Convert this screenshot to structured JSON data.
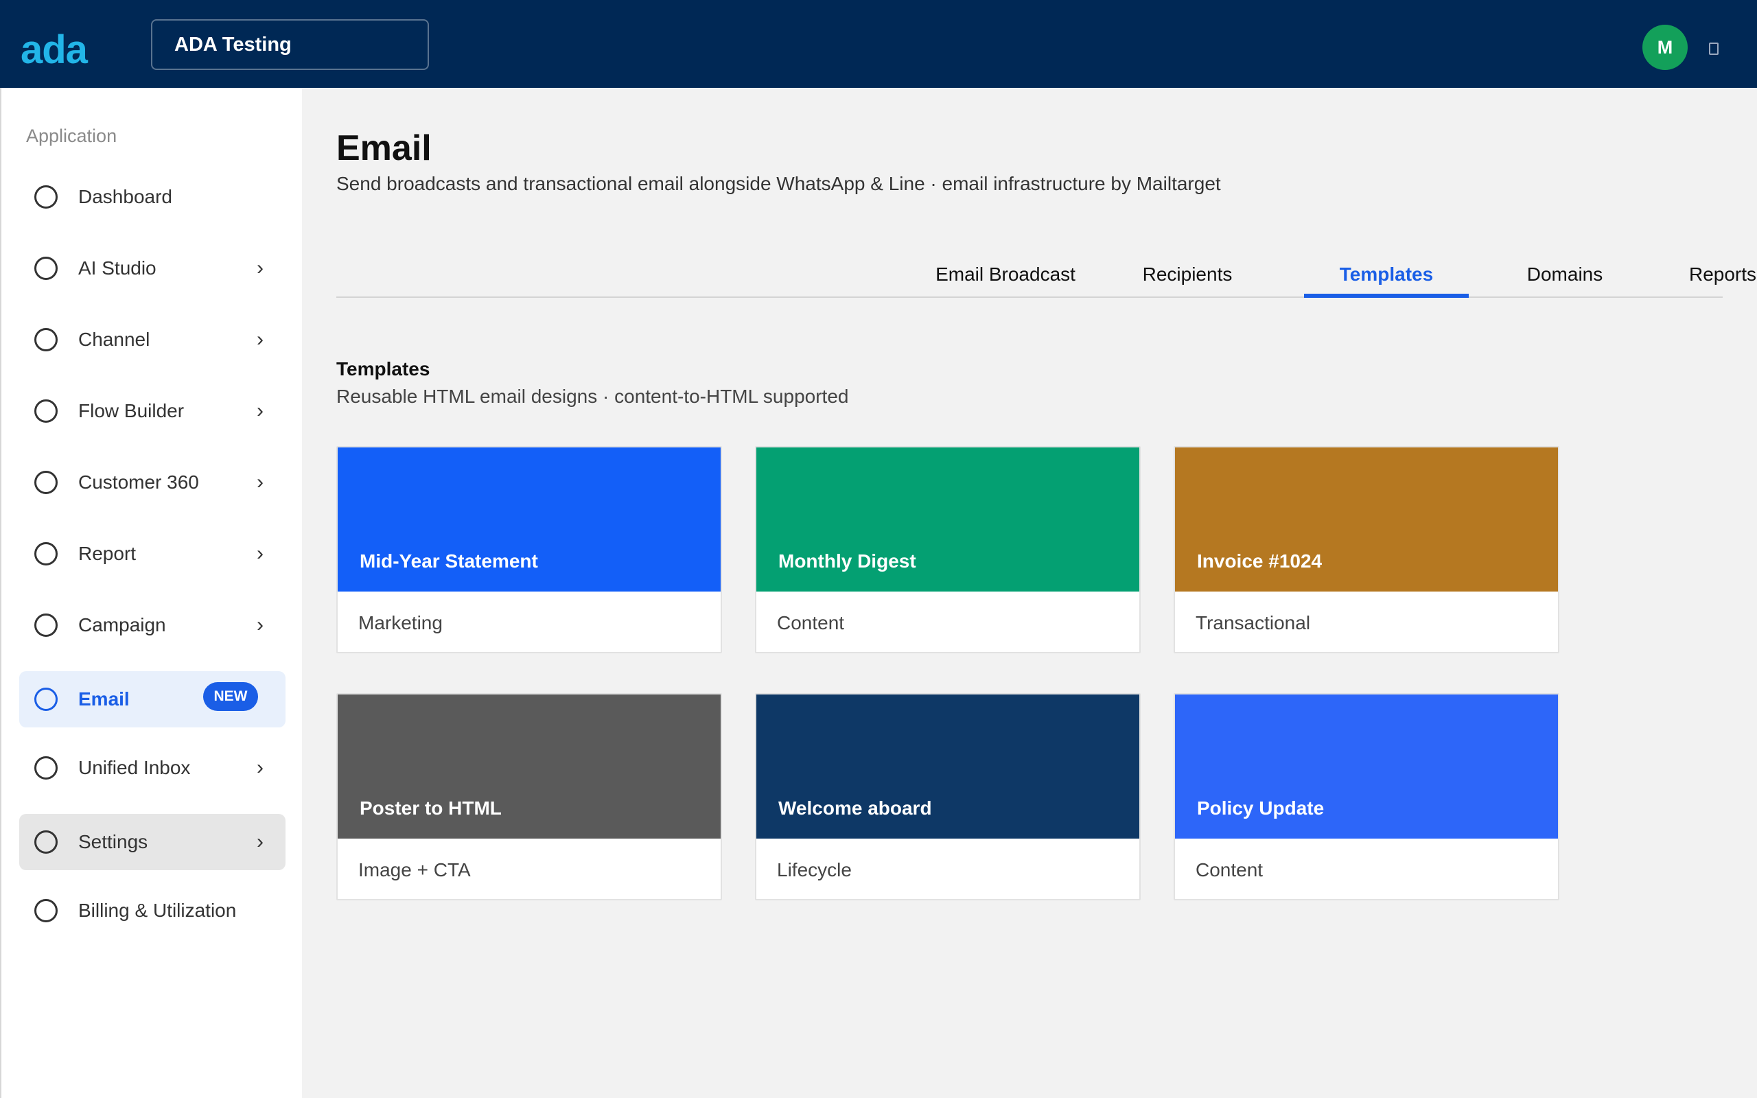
{
  "topbar": {
    "logo": "ada",
    "workspace": "ADA Testing",
    "avatar_initial": "M"
  },
  "sidebar": {
    "heading": "Application",
    "items": [
      {
        "label": "Dashboard",
        "chevron": ""
      },
      {
        "label": "AI Studio",
        "chevron": "›"
      },
      {
        "label": "Channel",
        "chevron": "›"
      },
      {
        "label": "Flow Builder",
        "chevron": "›"
      },
      {
        "label": "Customer 360",
        "chevron": "›"
      },
      {
        "label": "Report",
        "chevron": "›"
      },
      {
        "label": "Campaign",
        "chevron": "›"
      },
      {
        "label": "Email",
        "badge": "NEW",
        "active": true
      },
      {
        "label": "Unified Inbox",
        "chevron": "›"
      },
      {
        "label": "Settings",
        "chevron": "›"
      },
      {
        "label": "Billing & Utilization",
        "chevron": ""
      }
    ]
  },
  "page": {
    "title": "Email",
    "subtitle": "Send broadcasts and transactional email alongside WhatsApp & Line · email infrastructure by Mailtarget"
  },
  "tabs": [
    {
      "label": "Email Broadcast"
    },
    {
      "label": "Recipients"
    },
    {
      "label": "Templates",
      "active": true
    },
    {
      "label": "Domains"
    },
    {
      "label": "Reports"
    }
  ],
  "section": {
    "title": "Templates",
    "subtitle": "Reusable HTML email designs · content-to-HTML supported"
  },
  "templates": [
    {
      "name": "Mid-Year Statement",
      "category": "Marketing",
      "color": "#135ff8"
    },
    {
      "name": "Monthly Digest",
      "category": "Content",
      "color": "#04a072"
    },
    {
      "name": "Invoice #1024",
      "category": "Transactional",
      "color": "#b57821"
    },
    {
      "name": "Poster to HTML",
      "category": "Image + CTA",
      "color": "#5a5a5a"
    },
    {
      "name": "Welcome aboard",
      "category": "Lifecycle",
      "color": "#0e3866"
    },
    {
      "name": "Policy Update",
      "category": "Content",
      "color": "#2d66f9"
    }
  ]
}
